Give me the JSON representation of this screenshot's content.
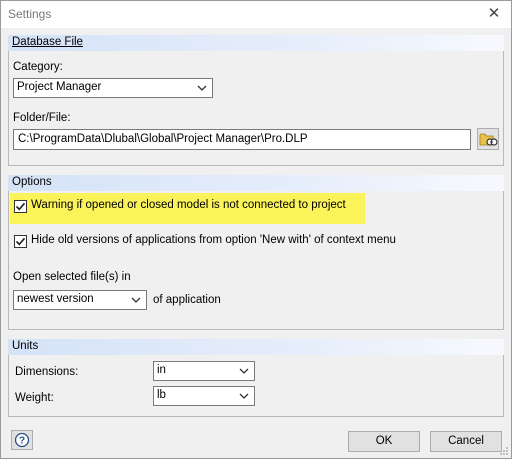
{
  "window": {
    "title": "Settings",
    "close_glyph": "✕"
  },
  "database_file": {
    "header": "Database File",
    "category_label": "Category:",
    "category_value": "Project Manager",
    "folder_label": "Folder/File:",
    "folder_value": "C:\\ProgramData\\Dlubal\\Global\\Project Manager\\Pro.DLP",
    "browse_icon": "folder-browse-icon"
  },
  "options": {
    "header": "Options",
    "warning_check": {
      "label": "Warning if opened or closed model is not connected to project",
      "checked": true
    },
    "hide_old_check": {
      "label": "Hide old versions of applications from option 'New with' of context menu",
      "checked": true
    },
    "open_in_label": "Open selected file(s) in",
    "version_value": "newest version",
    "of_application_label": "of application",
    "highlight_color": "#fbf35a"
  },
  "units": {
    "header": "Units",
    "dimensions_label": "Dimensions:",
    "dimensions_value": "in",
    "weight_label": "Weight:",
    "weight_value": "lb"
  },
  "footer": {
    "help_icon": "help-icon",
    "ok_label": "OK",
    "cancel_label": "Cancel"
  }
}
